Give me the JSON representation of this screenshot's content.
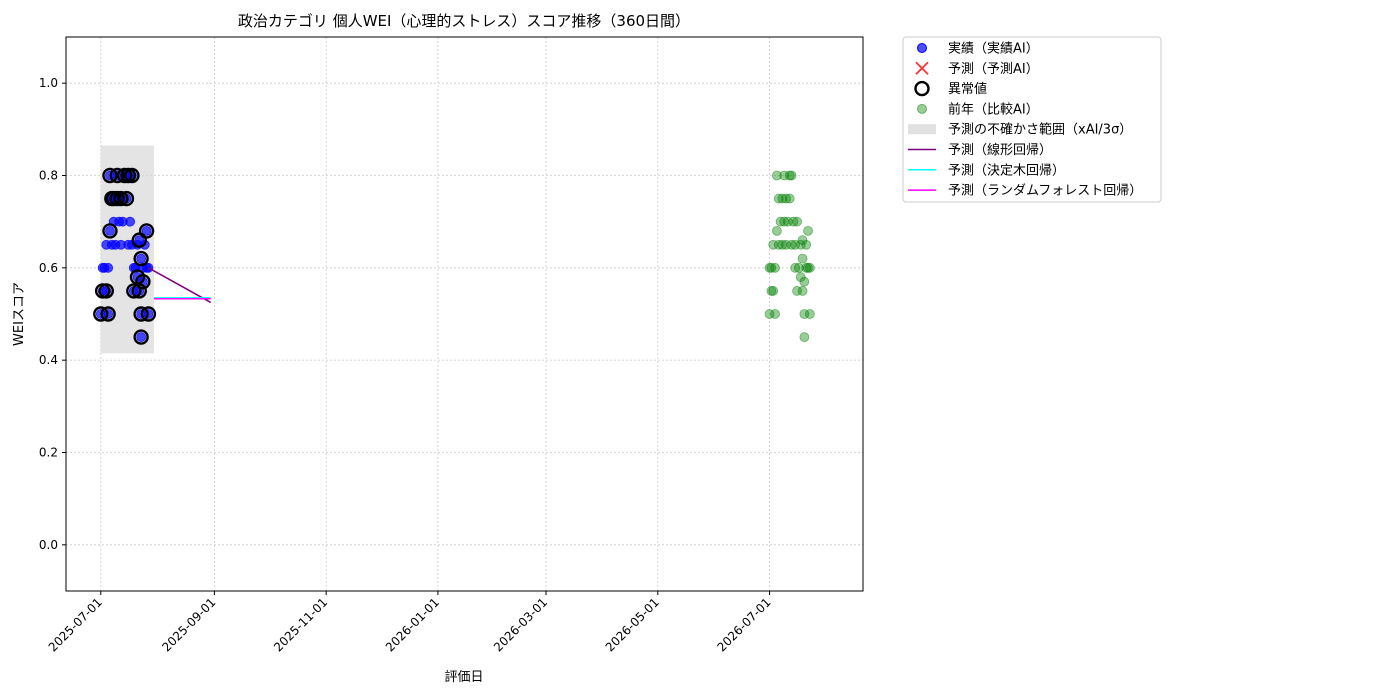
{
  "chart_data": {
    "type": "scatter",
    "title": "政治カテゴリ 個人WEI（心理的ストレス）スコア推移（360日間）",
    "xlabel": "評価日",
    "ylabel": "WEIスコア",
    "xlim": [
      "2025-06-12",
      "2026-08-21"
    ],
    "ylim": [
      -0.1,
      1.1
    ],
    "y_ticks": [
      0.0,
      0.2,
      0.4,
      0.6,
      0.8,
      1.0
    ],
    "y_tick_labels": [
      "0.0",
      "0.2",
      "0.4",
      "0.6",
      "0.8",
      "1.0"
    ],
    "x_ticks": [
      "2025-07-01",
      "2025-09-01",
      "2025-11-01",
      "2026-01-01",
      "2026-03-01",
      "2026-05-01",
      "2026-07-01"
    ],
    "grid": true,
    "legend_position": "outside-top-right",
    "colors": {
      "actual": "#0000ff",
      "previous_year": "#008000",
      "anomaly_edge": "#000000",
      "uncertainty_band": "#d9d9d9",
      "linear": "#800080",
      "decision_tree": "#00ffff",
      "random_forest": "#ff00ff",
      "prediction_ai": "#ff0000"
    },
    "legend": [
      {
        "key": "actual",
        "label": "実績（実績AI）"
      },
      {
        "key": "prediction_ai",
        "label": "予測（予測AI）"
      },
      {
        "key": "anomaly",
        "label": "異常値"
      },
      {
        "key": "previous_year",
        "label": "前年（比較AI）"
      },
      {
        "key": "uncertainty",
        "label": "予測の不確かさ範囲（xAI/3σ）"
      },
      {
        "key": "linear",
        "label": "予測（線形回帰）"
      },
      {
        "key": "decision_tree",
        "label": "予測（決定木回帰）"
      },
      {
        "key": "random_forest",
        "label": "予測（ランダムフォレスト回帰）"
      }
    ],
    "series": [
      {
        "key": "actual",
        "marker": "circle",
        "points": [
          {
            "x": "2025-07-01",
            "y": 0.5
          },
          {
            "x": "2025-07-02",
            "y": 0.6
          },
          {
            "x": "2025-07-02",
            "y": 0.55
          },
          {
            "x": "2025-07-03",
            "y": 0.6
          },
          {
            "x": "2025-07-04",
            "y": 0.55
          },
          {
            "x": "2025-07-04",
            "y": 0.65
          },
          {
            "x": "2025-07-05",
            "y": 0.5
          },
          {
            "x": "2025-07-05",
            "y": 0.6
          },
          {
            "x": "2025-07-06",
            "y": 0.8
          },
          {
            "x": "2025-07-06",
            "y": 0.68
          },
          {
            "x": "2025-07-07",
            "y": 0.65
          },
          {
            "x": "2025-07-07",
            "y": 0.75
          },
          {
            "x": "2025-07-08",
            "y": 0.7
          },
          {
            "x": "2025-07-08",
            "y": 0.75
          },
          {
            "x": "2025-07-09",
            "y": 0.65
          },
          {
            "x": "2025-07-10",
            "y": 0.75
          },
          {
            "x": "2025-07-10",
            "y": 0.8
          },
          {
            "x": "2025-07-11",
            "y": 0.7
          },
          {
            "x": "2025-07-12",
            "y": 0.65
          },
          {
            "x": "2025-07-12",
            "y": 0.75
          },
          {
            "x": "2025-07-13",
            "y": 0.7
          },
          {
            "x": "2025-07-14",
            "y": 0.8
          },
          {
            "x": "2025-07-15",
            "y": 0.75
          },
          {
            "x": "2025-07-16",
            "y": 0.65
          },
          {
            "x": "2025-07-16",
            "y": 0.8
          },
          {
            "x": "2025-07-17",
            "y": 0.7
          },
          {
            "x": "2025-07-18",
            "y": 0.8
          },
          {
            "x": "2025-07-18",
            "y": 0.65
          },
          {
            "x": "2025-07-19",
            "y": 0.55
          },
          {
            "x": "2025-07-19",
            "y": 0.6
          },
          {
            "x": "2025-07-20",
            "y": 0.6
          },
          {
            "x": "2025-07-21",
            "y": 0.58
          },
          {
            "x": "2025-07-21",
            "y": 0.65
          },
          {
            "x": "2025-07-22",
            "y": 0.55
          },
          {
            "x": "2025-07-22",
            "y": 0.66
          },
          {
            "x": "2025-07-23",
            "y": 0.62
          },
          {
            "x": "2025-07-23",
            "y": 0.5
          },
          {
            "x": "2025-07-23",
            "y": 0.45
          },
          {
            "x": "2025-07-24",
            "y": 0.57
          },
          {
            "x": "2025-07-24",
            "y": 0.6
          },
          {
            "x": "2025-07-25",
            "y": 0.65
          },
          {
            "x": "2025-07-26",
            "y": 0.68
          },
          {
            "x": "2025-07-26",
            "y": 0.6
          },
          {
            "x": "2025-07-27",
            "y": 0.5
          },
          {
            "x": "2025-07-27",
            "y": 0.6
          }
        ]
      },
      {
        "key": "anomaly",
        "marker": "ring",
        "points": [
          {
            "x": "2025-07-01",
            "y": 0.5
          },
          {
            "x": "2025-07-02",
            "y": 0.55
          },
          {
            "x": "2025-07-04",
            "y": 0.55
          },
          {
            "x": "2025-07-05",
            "y": 0.5
          },
          {
            "x": "2025-07-06",
            "y": 0.8
          },
          {
            "x": "2025-07-06",
            "y": 0.68
          },
          {
            "x": "2025-07-07",
            "y": 0.75
          },
          {
            "x": "2025-07-08",
            "y": 0.75
          },
          {
            "x": "2025-07-10",
            "y": 0.75
          },
          {
            "x": "2025-07-10",
            "y": 0.8
          },
          {
            "x": "2025-07-12",
            "y": 0.75
          },
          {
            "x": "2025-07-14",
            "y": 0.8
          },
          {
            "x": "2025-07-15",
            "y": 0.75
          },
          {
            "x": "2025-07-16",
            "y": 0.8
          },
          {
            "x": "2025-07-18",
            "y": 0.8
          },
          {
            "x": "2025-07-19",
            "y": 0.55
          },
          {
            "x": "2025-07-21",
            "y": 0.58
          },
          {
            "x": "2025-07-22",
            "y": 0.55
          },
          {
            "x": "2025-07-22",
            "y": 0.66
          },
          {
            "x": "2025-07-23",
            "y": 0.62
          },
          {
            "x": "2025-07-23",
            "y": 0.5
          },
          {
            "x": "2025-07-23",
            "y": 0.45
          },
          {
            "x": "2025-07-24",
            "y": 0.57
          },
          {
            "x": "2025-07-26",
            "y": 0.68
          },
          {
            "x": "2025-07-27",
            "y": 0.5
          }
        ]
      },
      {
        "key": "previous_year",
        "marker": "circle",
        "points": [
          {
            "x": "2026-07-01",
            "y": 0.5
          },
          {
            "x": "2026-07-01",
            "y": 0.6
          },
          {
            "x": "2026-07-02",
            "y": 0.55
          },
          {
            "x": "2026-07-02",
            "y": 0.6
          },
          {
            "x": "2026-07-03",
            "y": 0.55
          },
          {
            "x": "2026-07-03",
            "y": 0.65
          },
          {
            "x": "2026-07-04",
            "y": 0.5
          },
          {
            "x": "2026-07-04",
            "y": 0.6
          },
          {
            "x": "2026-07-05",
            "y": 0.8
          },
          {
            "x": "2026-07-05",
            "y": 0.68
          },
          {
            "x": "2026-07-06",
            "y": 0.65
          },
          {
            "x": "2026-07-06",
            "y": 0.75
          },
          {
            "x": "2026-07-07",
            "y": 0.7
          },
          {
            "x": "2026-07-08",
            "y": 0.75
          },
          {
            "x": "2026-07-08",
            "y": 0.65
          },
          {
            "x": "2026-07-09",
            "y": 0.7
          },
          {
            "x": "2026-07-09",
            "y": 0.8
          },
          {
            "x": "2026-07-10",
            "y": 0.75
          },
          {
            "x": "2026-07-10",
            "y": 0.65
          },
          {
            "x": "2026-07-11",
            "y": 0.7
          },
          {
            "x": "2026-07-12",
            "y": 0.8
          },
          {
            "x": "2026-07-12",
            "y": 0.75
          },
          {
            "x": "2026-07-13",
            "y": 0.65
          },
          {
            "x": "2026-07-13",
            "y": 0.8
          },
          {
            "x": "2026-07-14",
            "y": 0.7
          },
          {
            "x": "2026-07-15",
            "y": 0.6
          },
          {
            "x": "2026-07-15",
            "y": 0.65
          },
          {
            "x": "2026-07-16",
            "y": 0.55
          },
          {
            "x": "2026-07-16",
            "y": 0.7
          },
          {
            "x": "2026-07-17",
            "y": 0.6
          },
          {
            "x": "2026-07-18",
            "y": 0.58
          },
          {
            "x": "2026-07-18",
            "y": 0.65
          },
          {
            "x": "2026-07-19",
            "y": 0.55
          },
          {
            "x": "2026-07-19",
            "y": 0.66
          },
          {
            "x": "2026-07-19",
            "y": 0.62
          },
          {
            "x": "2026-07-20",
            "y": 0.5
          },
          {
            "x": "2026-07-20",
            "y": 0.45
          },
          {
            "x": "2026-07-20",
            "y": 0.57
          },
          {
            "x": "2026-07-21",
            "y": 0.6
          },
          {
            "x": "2026-07-21",
            "y": 0.65
          },
          {
            "x": "2026-07-22",
            "y": 0.68
          },
          {
            "x": "2026-07-22",
            "y": 0.6
          },
          {
            "x": "2026-07-23",
            "y": 0.5
          },
          {
            "x": "2026-07-23",
            "y": 0.6
          }
        ]
      }
    ],
    "uncertainty_band": {
      "x_start": "2025-07-01",
      "x_end": "2025-07-30",
      "y_low": 0.415,
      "y_high": 0.865
    },
    "prediction_lines": [
      {
        "key": "linear",
        "points": [
          {
            "x": "2025-07-27",
            "y": 0.6
          },
          {
            "x": "2025-08-30",
            "y": 0.525
          }
        ]
      },
      {
        "key": "decision_tree",
        "points": [
          {
            "x": "2025-07-30",
            "y": 0.535
          },
          {
            "x": "2025-08-30",
            "y": 0.535
          }
        ]
      },
      {
        "key": "random_forest",
        "points": [
          {
            "x": "2025-07-30",
            "y": 0.533
          },
          {
            "x": "2025-08-30",
            "y": 0.533
          }
        ]
      }
    ]
  }
}
